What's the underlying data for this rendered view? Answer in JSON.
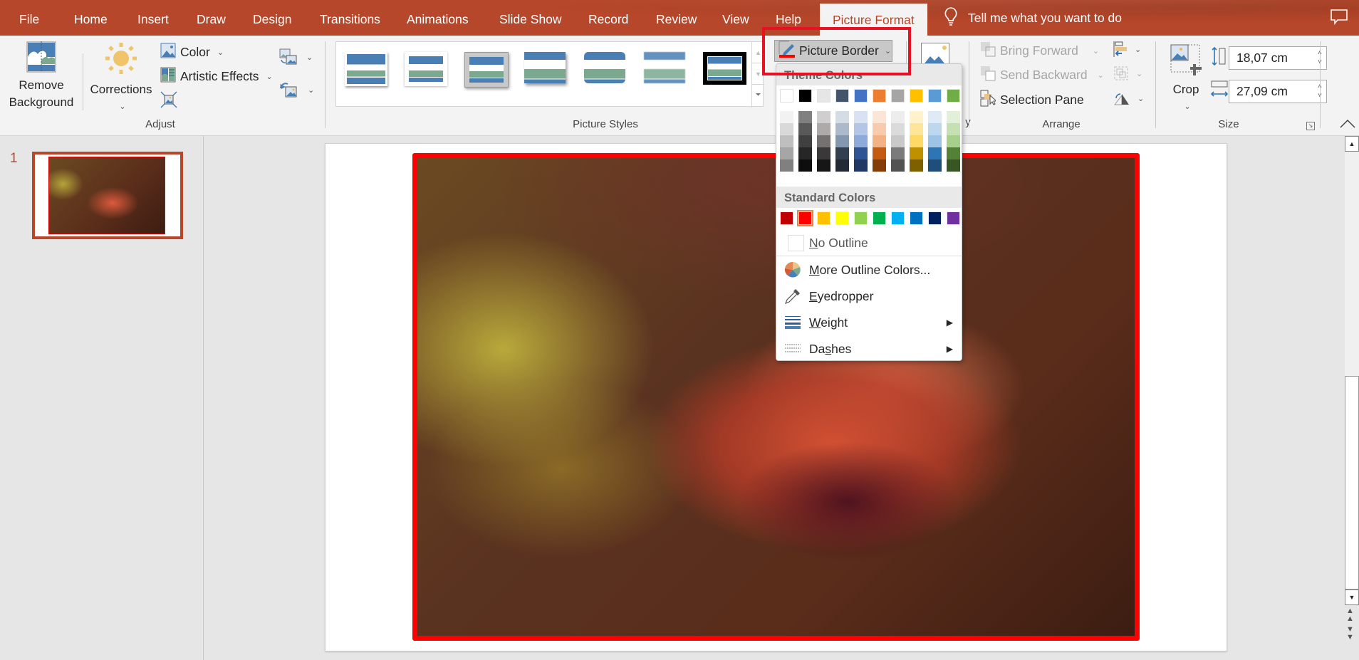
{
  "tabs": [
    {
      "label": "File"
    },
    {
      "label": "Home"
    },
    {
      "label": "Insert"
    },
    {
      "label": "Draw"
    },
    {
      "label": "Design"
    },
    {
      "label": "Transitions"
    },
    {
      "label": "Animations"
    },
    {
      "label": "Slide Show"
    },
    {
      "label": "Record"
    },
    {
      "label": "Review"
    },
    {
      "label": "View"
    },
    {
      "label": "Help"
    },
    {
      "label": "Picture Format",
      "active": true
    }
  ],
  "tell_me": "Tell me what you want to do",
  "ribbon": {
    "adjust": {
      "label": "Adjust",
      "remove_background_line1": "Remove",
      "remove_background_line2": "Background",
      "corrections": "Corrections",
      "color": "Color",
      "artistic_effects": "Artistic Effects"
    },
    "picture_styles": {
      "label": "Picture Styles",
      "styles_count": 7
    },
    "picture_border": "Picture Border",
    "arrange": {
      "label": "Arrange",
      "bring_forward": "Bring Forward",
      "send_backward": "Send Backward",
      "selection_pane": "Selection Pane"
    },
    "size": {
      "label": "Size",
      "crop": "Crop",
      "height": "18,07 cm",
      "width": "27,09 cm"
    },
    "accessibility_partial": "y"
  },
  "slides_panel": {
    "slide_number": "1"
  },
  "border_menu": {
    "theme_colors_label": "Theme Colors",
    "theme_colors": [
      "#ffffff",
      "#000000",
      "#e7e6e6",
      "#44546a",
      "#4472c4",
      "#ed7d31",
      "#a5a5a5",
      "#ffc000",
      "#5b9bd5",
      "#70ad47"
    ],
    "theme_shades": [
      [
        "#f2f2f2",
        "#d9d9d9",
        "#bfbfbf",
        "#a6a6a6",
        "#808080"
      ],
      [
        "#808080",
        "#595959",
        "#404040",
        "#262626",
        "#0d0d0d"
      ],
      [
        "#d0cece",
        "#aeaaaa",
        "#757171",
        "#3a3838",
        "#171616"
      ],
      [
        "#d6dce4",
        "#acb9ca",
        "#8497b0",
        "#333f4f",
        "#222a35"
      ],
      [
        "#d9e2f3",
        "#b4c6e7",
        "#8eaadb",
        "#2f5496",
        "#1f3864"
      ],
      [
        "#fbe5d5",
        "#f7cbac",
        "#f4b183",
        "#c55a11",
        "#843c0b"
      ],
      [
        "#ededed",
        "#dbdbdb",
        "#c9c9c9",
        "#7b7b7b",
        "#525252"
      ],
      [
        "#fff2cc",
        "#fee599",
        "#ffd965",
        "#bf9000",
        "#7f6000"
      ],
      [
        "#deebf6",
        "#bdd7ee",
        "#9dc3e6",
        "#2e75b5",
        "#1e4e79"
      ],
      [
        "#e2efd9",
        "#c5e0b3",
        "#a8d08d",
        "#538135",
        "#375623"
      ]
    ],
    "standard_colors_label": "Standard Colors",
    "standard_colors": [
      "#c00000",
      "#ff0000",
      "#ffc000",
      "#ffff00",
      "#92d050",
      "#00b050",
      "#00b0f0",
      "#0070c0",
      "#002060",
      "#7030a0"
    ],
    "selected_standard_index": 1,
    "no_outline": "No Outline",
    "more_colors": "More Outline Colors...",
    "eyedropper": "Eyedropper",
    "weight": "Weight",
    "dashes": "Dashes"
  },
  "picture": {
    "border_color": "#ff0000"
  },
  "colors": {
    "accent": "#b7472a",
    "annotation": "#e81123"
  }
}
